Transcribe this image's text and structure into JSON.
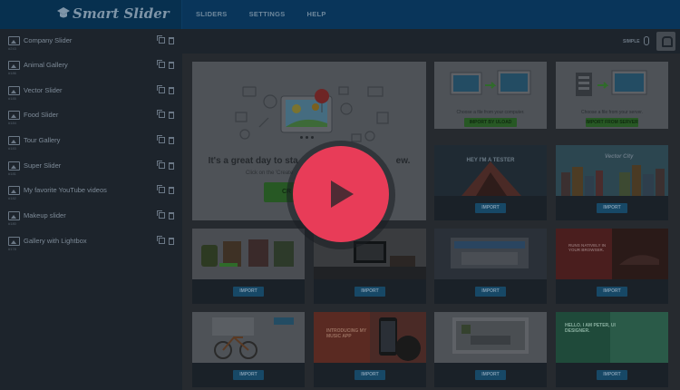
{
  "app": {
    "logo_text": "Smart Slider"
  },
  "nav": [
    {
      "label": "SLIDERS"
    },
    {
      "label": "SETTINGS"
    },
    {
      "label": "HELP"
    }
  ],
  "sidebar": {
    "items": [
      {
        "label": "Company Slider",
        "id": "#243"
      },
      {
        "label": "Animal Gallery",
        "id": "#186"
      },
      {
        "label": "Vector Slider",
        "id": "#185"
      },
      {
        "label": "Food Slider",
        "id": "#184"
      },
      {
        "label": "Tour Gallery",
        "id": "#183"
      },
      {
        "label": "Super Slider",
        "id": "#181"
      },
      {
        "label": "My favorite YouTube videos",
        "id": "#182"
      },
      {
        "label": "Makeup slider",
        "id": "#180"
      },
      {
        "label": "Gallery with Lightbox",
        "id": "#178"
      }
    ]
  },
  "subbar": {
    "mode_label": "SIMPLE"
  },
  "welcome": {
    "title": "It's a great day to sta",
    "title_tail": "ew.",
    "text": "Click on the 'Create",
    "create_label": "CR"
  },
  "upload": {
    "computer": {
      "caption": "Choose a file from your computer.",
      "button": "IMPORT BY ULOAD"
    },
    "server": {
      "caption": "Choose a file from your server.",
      "button": "IMPORT FROM SERVER"
    }
  },
  "templates": {
    "import_label": "IMPORT",
    "cards": [
      {
        "text": "HEY I'M A TESTER"
      },
      {
        "text": "Vector City"
      },
      {
        "text": ""
      },
      {
        "text": ""
      },
      {
        "text": ""
      },
      {
        "text": "RUNS NATIVELY IN YOUR BROWSER."
      },
      {
        "text": ""
      },
      {
        "text": "INTRODUCING MY MUSIC APP"
      },
      {
        "text": ""
      },
      {
        "text": "HELLO. I AM PETER, UI DESIGNER."
      }
    ]
  },
  "colors": {
    "accent_green": "#4fa846",
    "play_button": "#e83c58",
    "import_blue": "#1e82b7"
  }
}
